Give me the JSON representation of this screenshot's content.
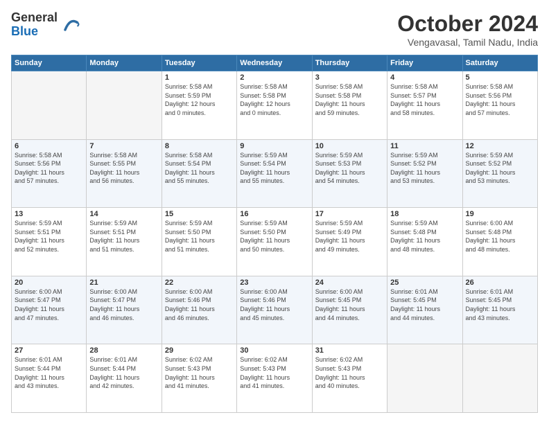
{
  "header": {
    "logo_general": "General",
    "logo_blue": "Blue",
    "title": "October 2024",
    "subtitle": "Vengavasal, Tamil Nadu, India"
  },
  "days_of_week": [
    "Sunday",
    "Monday",
    "Tuesday",
    "Wednesday",
    "Thursday",
    "Friday",
    "Saturday"
  ],
  "weeks": [
    [
      {
        "day": "",
        "info": ""
      },
      {
        "day": "",
        "info": ""
      },
      {
        "day": "1",
        "info": "Sunrise: 5:58 AM\nSunset: 5:59 PM\nDaylight: 12 hours\nand 0 minutes."
      },
      {
        "day": "2",
        "info": "Sunrise: 5:58 AM\nSunset: 5:58 PM\nDaylight: 12 hours\nand 0 minutes."
      },
      {
        "day": "3",
        "info": "Sunrise: 5:58 AM\nSunset: 5:58 PM\nDaylight: 11 hours\nand 59 minutes."
      },
      {
        "day": "4",
        "info": "Sunrise: 5:58 AM\nSunset: 5:57 PM\nDaylight: 11 hours\nand 58 minutes."
      },
      {
        "day": "5",
        "info": "Sunrise: 5:58 AM\nSunset: 5:56 PM\nDaylight: 11 hours\nand 57 minutes."
      }
    ],
    [
      {
        "day": "6",
        "info": "Sunrise: 5:58 AM\nSunset: 5:56 PM\nDaylight: 11 hours\nand 57 minutes."
      },
      {
        "day": "7",
        "info": "Sunrise: 5:58 AM\nSunset: 5:55 PM\nDaylight: 11 hours\nand 56 minutes."
      },
      {
        "day": "8",
        "info": "Sunrise: 5:58 AM\nSunset: 5:54 PM\nDaylight: 11 hours\nand 55 minutes."
      },
      {
        "day": "9",
        "info": "Sunrise: 5:59 AM\nSunset: 5:54 PM\nDaylight: 11 hours\nand 55 minutes."
      },
      {
        "day": "10",
        "info": "Sunrise: 5:59 AM\nSunset: 5:53 PM\nDaylight: 11 hours\nand 54 minutes."
      },
      {
        "day": "11",
        "info": "Sunrise: 5:59 AM\nSunset: 5:52 PM\nDaylight: 11 hours\nand 53 minutes."
      },
      {
        "day": "12",
        "info": "Sunrise: 5:59 AM\nSunset: 5:52 PM\nDaylight: 11 hours\nand 53 minutes."
      }
    ],
    [
      {
        "day": "13",
        "info": "Sunrise: 5:59 AM\nSunset: 5:51 PM\nDaylight: 11 hours\nand 52 minutes."
      },
      {
        "day": "14",
        "info": "Sunrise: 5:59 AM\nSunset: 5:51 PM\nDaylight: 11 hours\nand 51 minutes."
      },
      {
        "day": "15",
        "info": "Sunrise: 5:59 AM\nSunset: 5:50 PM\nDaylight: 11 hours\nand 51 minutes."
      },
      {
        "day": "16",
        "info": "Sunrise: 5:59 AM\nSunset: 5:50 PM\nDaylight: 11 hours\nand 50 minutes."
      },
      {
        "day": "17",
        "info": "Sunrise: 5:59 AM\nSunset: 5:49 PM\nDaylight: 11 hours\nand 49 minutes."
      },
      {
        "day": "18",
        "info": "Sunrise: 5:59 AM\nSunset: 5:48 PM\nDaylight: 11 hours\nand 48 minutes."
      },
      {
        "day": "19",
        "info": "Sunrise: 6:00 AM\nSunset: 5:48 PM\nDaylight: 11 hours\nand 48 minutes."
      }
    ],
    [
      {
        "day": "20",
        "info": "Sunrise: 6:00 AM\nSunset: 5:47 PM\nDaylight: 11 hours\nand 47 minutes."
      },
      {
        "day": "21",
        "info": "Sunrise: 6:00 AM\nSunset: 5:47 PM\nDaylight: 11 hours\nand 46 minutes."
      },
      {
        "day": "22",
        "info": "Sunrise: 6:00 AM\nSunset: 5:46 PM\nDaylight: 11 hours\nand 46 minutes."
      },
      {
        "day": "23",
        "info": "Sunrise: 6:00 AM\nSunset: 5:46 PM\nDaylight: 11 hours\nand 45 minutes."
      },
      {
        "day": "24",
        "info": "Sunrise: 6:00 AM\nSunset: 5:45 PM\nDaylight: 11 hours\nand 44 minutes."
      },
      {
        "day": "25",
        "info": "Sunrise: 6:01 AM\nSunset: 5:45 PM\nDaylight: 11 hours\nand 44 minutes."
      },
      {
        "day": "26",
        "info": "Sunrise: 6:01 AM\nSunset: 5:45 PM\nDaylight: 11 hours\nand 43 minutes."
      }
    ],
    [
      {
        "day": "27",
        "info": "Sunrise: 6:01 AM\nSunset: 5:44 PM\nDaylight: 11 hours\nand 43 minutes."
      },
      {
        "day": "28",
        "info": "Sunrise: 6:01 AM\nSunset: 5:44 PM\nDaylight: 11 hours\nand 42 minutes."
      },
      {
        "day": "29",
        "info": "Sunrise: 6:02 AM\nSunset: 5:43 PM\nDaylight: 11 hours\nand 41 minutes."
      },
      {
        "day": "30",
        "info": "Sunrise: 6:02 AM\nSunset: 5:43 PM\nDaylight: 11 hours\nand 41 minutes."
      },
      {
        "day": "31",
        "info": "Sunrise: 6:02 AM\nSunset: 5:43 PM\nDaylight: 11 hours\nand 40 minutes."
      },
      {
        "day": "",
        "info": ""
      },
      {
        "day": "",
        "info": ""
      }
    ]
  ]
}
